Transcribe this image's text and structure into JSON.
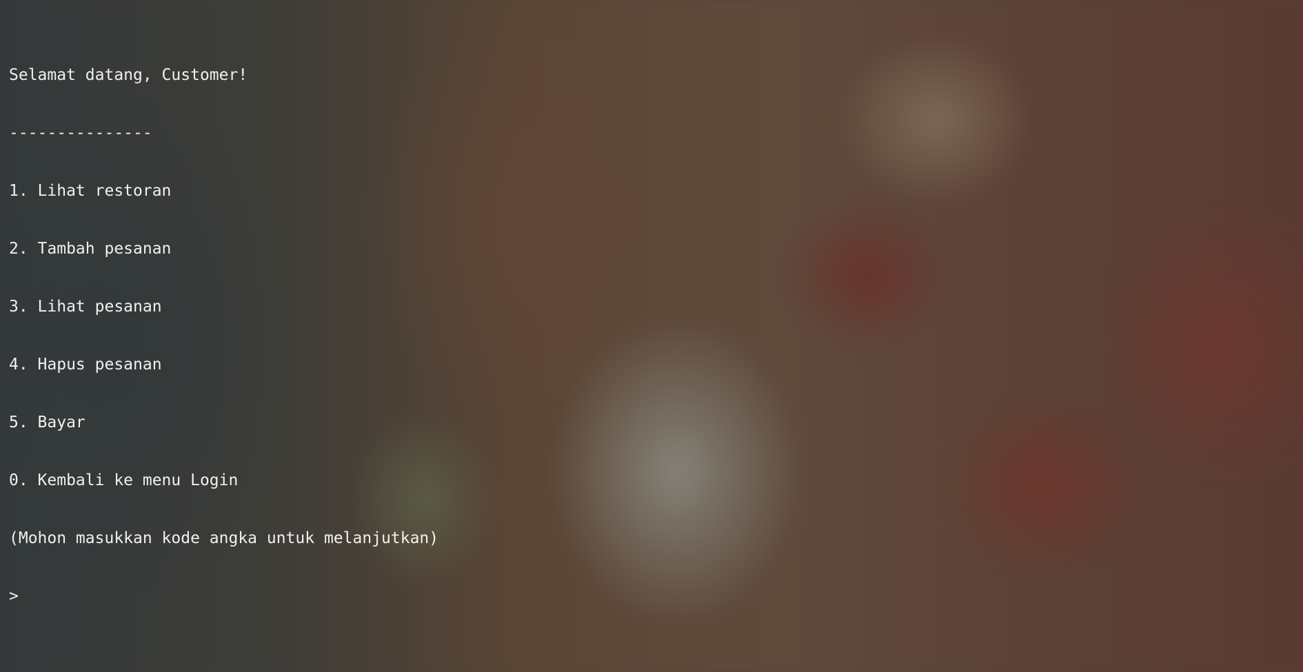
{
  "terminal": {
    "greeting": "Selamat datang, Customer!",
    "separator": "---------------",
    "menu_items": [
      "1. Lihat restoran",
      "2. Tambah pesanan",
      "3. Lihat pesanan",
      "4. Hapus pesanan",
      "5. Bayar",
      "0. Kembali ke menu Login"
    ],
    "instruction": "(Mohon masukkan kode angka untuk melanjutkan)",
    "prompt": ">"
  }
}
